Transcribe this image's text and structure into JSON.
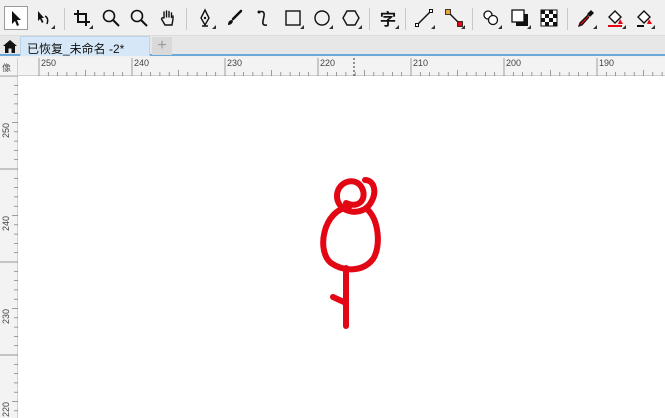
{
  "toolbar": {
    "tools": [
      {
        "name": "pick-tool",
        "label": "Pick"
      },
      {
        "name": "shape-tool",
        "label": "Shape"
      },
      {
        "name": "crop-tool",
        "label": "Crop"
      },
      {
        "name": "zoom-tool",
        "label": "Zoom"
      },
      {
        "name": "pan-zoom-tool",
        "label": "Zoom"
      },
      {
        "name": "hand-tool",
        "label": "Pan"
      },
      {
        "name": "pen-tool",
        "label": "Pen"
      },
      {
        "name": "brush-tool",
        "label": "Artistic media"
      },
      {
        "name": "spiral-tool",
        "label": "Spiral"
      },
      {
        "name": "rectangle-tool",
        "label": "Rectangle"
      },
      {
        "name": "ellipse-tool",
        "label": "Ellipse"
      },
      {
        "name": "polygon-tool",
        "label": "Polygon"
      },
      {
        "name": "text-tool",
        "label": "Text"
      },
      {
        "name": "dimension-tool",
        "label": "Dimension"
      },
      {
        "name": "connector-tool",
        "label": "Connector"
      },
      {
        "name": "blend-tool",
        "label": "Blend"
      },
      {
        "name": "shadow-tool",
        "label": "Drop shadow"
      },
      {
        "name": "transparency-tool",
        "label": "Transparency"
      },
      {
        "name": "eyedropper-tool",
        "label": "Eyedropper"
      },
      {
        "name": "fill-tool",
        "label": "Interactive fill"
      },
      {
        "name": "smart-fill-tool",
        "label": "Smart fill"
      }
    ],
    "text_glyph": "字"
  },
  "tabs": {
    "document_title": "已恢复_未命名 -2*",
    "add_label": "+"
  },
  "ruler": {
    "corner_label": "像",
    "horizontal": [
      "250",
      "240",
      "230",
      "220",
      "210",
      "200",
      "190"
    ],
    "vertical": [
      "250",
      "240",
      "230",
      "220"
    ]
  },
  "colors": {
    "accent": "#e30613",
    "tab_active": "#d6e8f7",
    "tab_underline": "#6aa8d8"
  }
}
